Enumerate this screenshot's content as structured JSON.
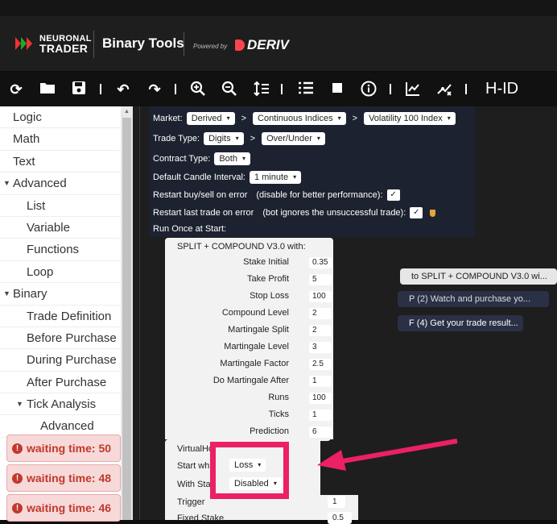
{
  "header": {
    "logo_line1": "NEURONAL",
    "logo_line2": "TRADER",
    "app_title": "Binary Tools",
    "powered_by": "Powered by",
    "partner": "DERIV"
  },
  "toolbar": {
    "icons": [
      "reset-icon",
      "open-folder-icon",
      "save-icon",
      "undo-icon",
      "redo-icon",
      "zoom-in-icon",
      "zoom-out-icon",
      "sort-icon",
      "list-icon",
      "stop-icon",
      "info-icon",
      "chart-icon",
      "transform-icon"
    ],
    "user_code": "H-ID"
  },
  "sidebar": {
    "items": [
      {
        "label": "Logic"
      },
      {
        "label": "Math"
      },
      {
        "label": "Text"
      },
      {
        "label": "Advanced"
      },
      {
        "label": "List"
      },
      {
        "label": "Variable"
      },
      {
        "label": "Functions"
      },
      {
        "label": "Loop"
      },
      {
        "label": "Binary"
      },
      {
        "label": "Trade Definition"
      },
      {
        "label": "Before Purchase"
      },
      {
        "label": "During Purchase"
      },
      {
        "label": "After Purchase"
      },
      {
        "label": "Tick Analysis"
      },
      {
        "label": "Advanced"
      }
    ]
  },
  "trade": {
    "market_label": "Market:",
    "market": "Derived",
    "submarket": "Continuous Indices",
    "symbol": "Volatility 100 Index",
    "trade_type_label": "Trade Type:",
    "trade_type": "Digits",
    "trade_subtype": "Over/Under",
    "contract_type_label": "Contract Type:",
    "contract_type": "Both",
    "candle_label": "Default Candle Interval:",
    "candle": "1 minute",
    "restart_label": "Restart buy/sell on error",
    "restart_note": "(disable for better performance):",
    "restart_last_label": "Restart last trade on error",
    "restart_last_note": "(bot ignores the unsuccessful trade):",
    "run_once_label": "Run Once at Start:",
    "check": "✓"
  },
  "procedure": {
    "title": "SPLIT + COMPOUND V3.0    with:",
    "params": [
      {
        "label": "Stake Initial",
        "value": "0.35"
      },
      {
        "label": "Take Profit",
        "value": "5"
      },
      {
        "label": "Stop Loss",
        "value": "100"
      },
      {
        "label": "Compound Level",
        "value": "2"
      },
      {
        "label": "Martingale Split",
        "value": "2"
      },
      {
        "label": "Martingale Level",
        "value": "3"
      },
      {
        "label": "Martingale Factor",
        "value": "2.5"
      },
      {
        "label": "Do Martingale After",
        "value": "1"
      },
      {
        "label": "Runs",
        "value": "100"
      },
      {
        "label": "Ticks",
        "value": "1"
      },
      {
        "label": "Prediction",
        "value": "6"
      }
    ]
  },
  "virtualhook": {
    "title": "VirtualHo",
    "start_when_label": "Start wh",
    "start_when": "Loss",
    "with_stat_label": "With Sta",
    "with_stat": "Disabled",
    "trigger_label": "Trigger",
    "trigger": "1",
    "fixed_stake_label": "Fixed Stake",
    "fixed_stake": "0.5"
  },
  "side_blocks": {
    "b1": "to SPLIT + COMPOUND V3.0 wi...",
    "b2": "P (2) Watch and purchase yo...",
    "b3": "F (4) Get your trade result..."
  },
  "toasts": [
    {
      "text": "waiting time: 50"
    },
    {
      "text": "waiting time: 48"
    },
    {
      "text": "waiting time: 46"
    }
  ],
  "colors": {
    "accent_highlight": "#ec2064",
    "deriv_red": "#ff444f",
    "toast_text": "#c0392b",
    "block_dark": "#1d2230"
  }
}
